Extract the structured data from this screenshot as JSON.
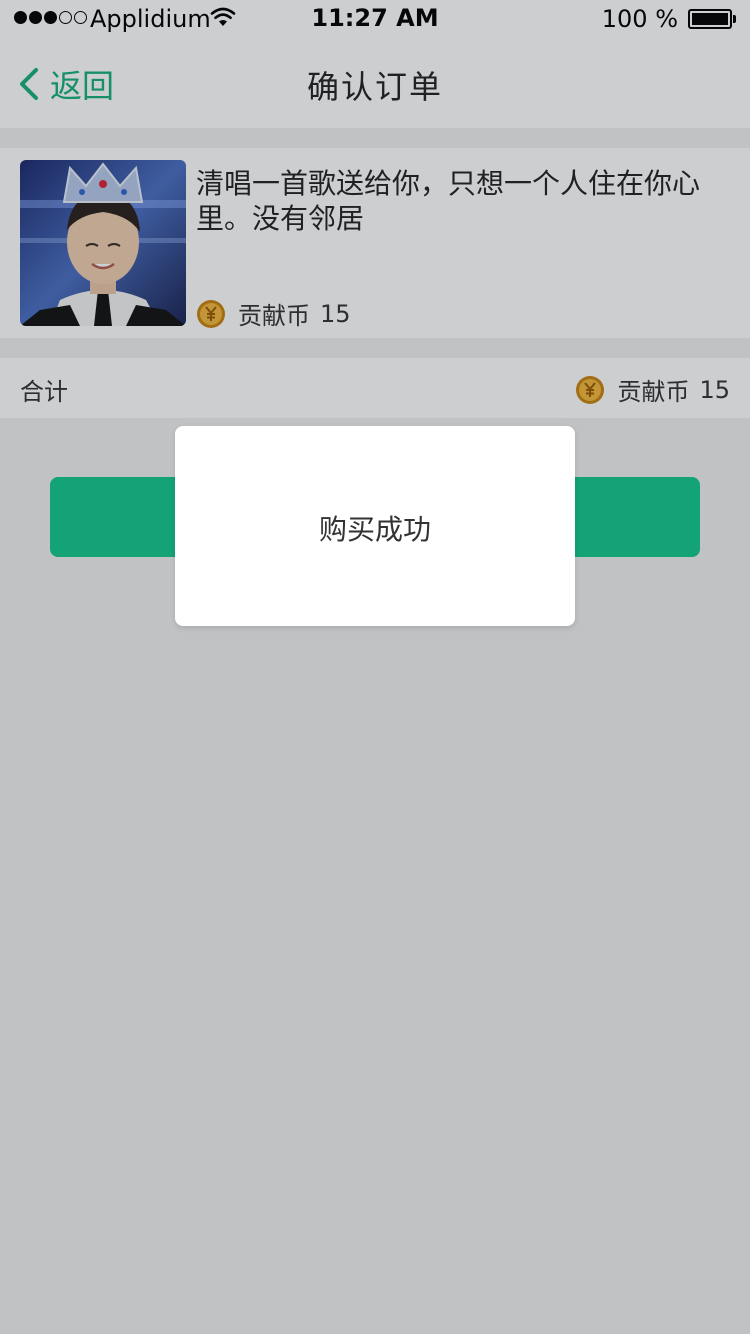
{
  "status_bar": {
    "carrier": "Applidium",
    "time": "11:27 AM",
    "battery": "100 %",
    "signal_bars_filled": 3,
    "signal_bars_total": 5
  },
  "nav": {
    "back_label": "返回",
    "title": "确认订单"
  },
  "product": {
    "description": "清唱一首歌送给你，只想一个人住在你心里。没有邻居",
    "currency_label": "贡献币",
    "price": "15"
  },
  "total": {
    "label": "合计",
    "currency_label": "贡献币",
    "amount": "15"
  },
  "toast": {
    "message": "购买成功"
  },
  "colors": {
    "accent": "#16b07c",
    "button": "#14c88e",
    "coin": "#e0a82e"
  },
  "icons": {
    "back": "chevron-left-icon",
    "coin": "yuan-coin-icon",
    "wifi": "wifi-icon",
    "battery": "battery-icon"
  }
}
